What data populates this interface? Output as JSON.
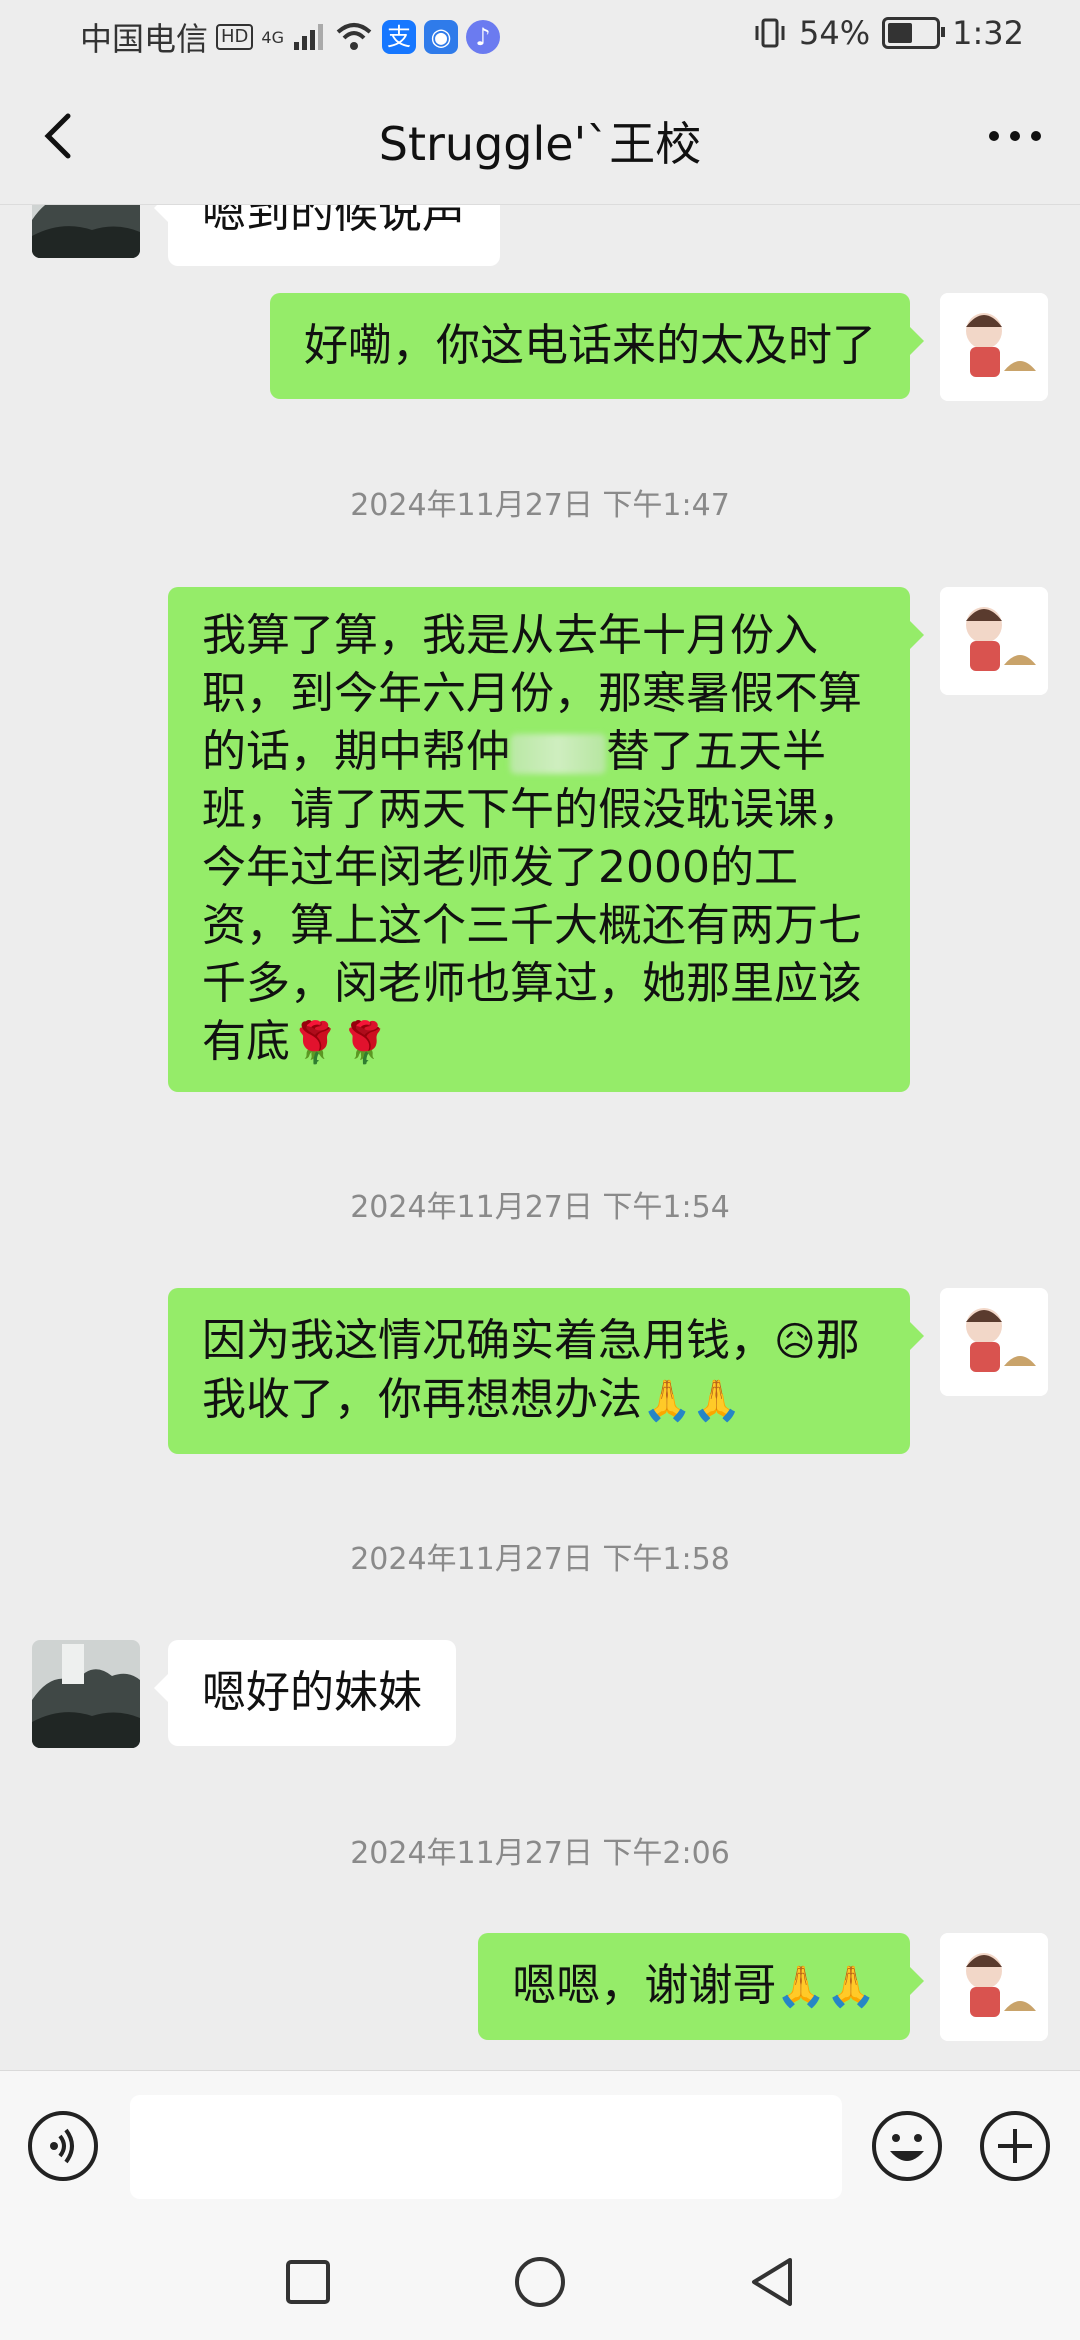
{
  "status_bar": {
    "carrier": "中国电信",
    "hd_badge": "HD",
    "network": "4G",
    "battery_percent": "54%",
    "time": "1:32"
  },
  "header": {
    "title": "Struggle'`王校",
    "back_icon": "chevron-left-icon",
    "more_icon": "more-dots-icon"
  },
  "messages": [
    {
      "kind": "in",
      "text": "嗯到的候说声"
    },
    {
      "kind": "out",
      "text": "好嘞，你这电话来的太及时了"
    },
    {
      "kind": "time",
      "text": "2024年11月27日 下午1:47"
    },
    {
      "kind": "out",
      "text_1": "我算了算，我是从去年十月份入职，到今年六月份，那寒暑假不算的话，期中帮仲",
      "text_2": "替了五天半班，请了两天下午的假没耽误课，今年过年闵老师发了2000的工资，算上这个三千大概还有两万七千多，闵老师也算过，她那里应该有底",
      "emojis": "🌹🌹"
    },
    {
      "kind": "time",
      "text": "2024年11月27日 下午1:54"
    },
    {
      "kind": "out",
      "text_1": "因为我这情况确实着急用钱，",
      "emoji_mid": "😥",
      "text_2": "那我收了，你再想想办法",
      "emojis": "🙏🙏"
    },
    {
      "kind": "time",
      "text": "2024年11月27日 下午1:58"
    },
    {
      "kind": "in",
      "text": "嗯好的妹妹"
    },
    {
      "kind": "time",
      "text": "2024年11月27日 下午2:06"
    },
    {
      "kind": "out",
      "text": "嗯嗯，谢谢哥",
      "emojis": "🙏🙏"
    }
  ],
  "input_bar": {
    "voice_icon": "voice-icon",
    "placeholder": "",
    "emoji_icon": "emoji-face-icon",
    "plus_icon": "plus-circle-icon"
  },
  "nav_bar": {
    "recents_icon": "square-icon",
    "home_icon": "circle-icon",
    "back_icon": "triangle-back-icon"
  },
  "colors": {
    "background": "#ededed",
    "outgoing_bubble": "#95ec69",
    "incoming_bubble": "#ffffff",
    "timestamp": "#8a8a8a"
  }
}
